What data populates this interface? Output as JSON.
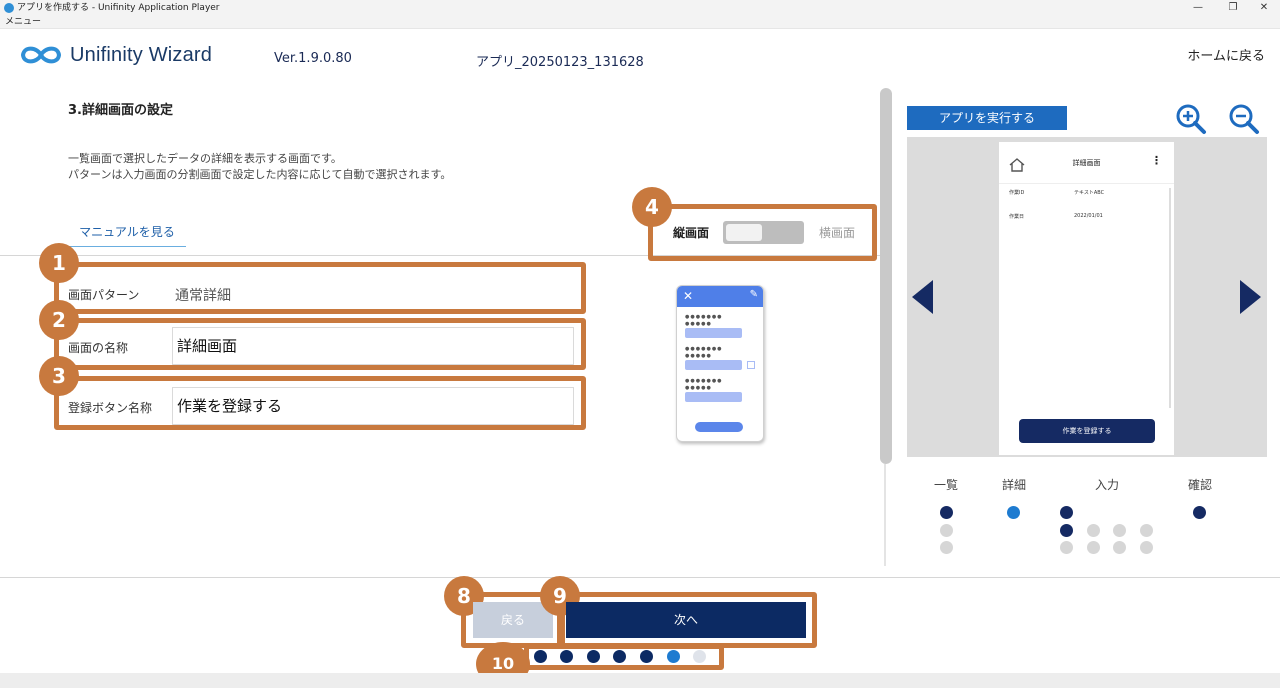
{
  "window": {
    "title": "アプリを作成する - Unifinity Application Player",
    "menu": "メニュー",
    "controls": [
      "—",
      "❐",
      "✕"
    ]
  },
  "header": {
    "logo_text": "Unifinity Wizard",
    "version": "Ver.1.9.0.80",
    "app_name": "アプリ_20250123_131628",
    "home_link": "ホームに戻る"
  },
  "section": {
    "title": "3.詳細画面の設定",
    "desc_line1": "一覧画面で選択したデータの詳細を表示する画面です。",
    "desc_line2": "パターンは入力画面の分割画面で設定した内容に応じて自動で選択されます。",
    "manual_link": "マニュアルを見る"
  },
  "form": {
    "pattern_label": "画面パターン",
    "pattern_value": "通常詳細",
    "name_label": "画面の名称",
    "name_value": "詳細画面",
    "button_label": "登録ボタン名称",
    "button_value": "作業を登録する"
  },
  "orientation": {
    "portrait": "縦画面",
    "landscape": "横画面",
    "selected": "縦画面"
  },
  "callouts": [
    "1",
    "2",
    "3",
    "4",
    "8",
    "9",
    "10"
  ],
  "preview": {
    "run_button": "アプリを実行する",
    "phone_title": "詳細画面",
    "rows": [
      {
        "label": "作業ID",
        "value": "テキストABC"
      },
      {
        "label": "作業日",
        "value": "2022/01/01"
      }
    ],
    "phone_button": "作業を登録する",
    "screen_labels": [
      "一覧",
      "詳細",
      "入力",
      "確認"
    ]
  },
  "footer": {
    "back_label": "戻る",
    "next_label": "次へ",
    "progress_steps": 7,
    "progress_current": 6
  },
  "colors": {
    "callout": "#c8793e",
    "primary_dark": "#0c2a63",
    "accent_blue": "#1e6bbf",
    "current_dot": "#1e7bd0"
  }
}
